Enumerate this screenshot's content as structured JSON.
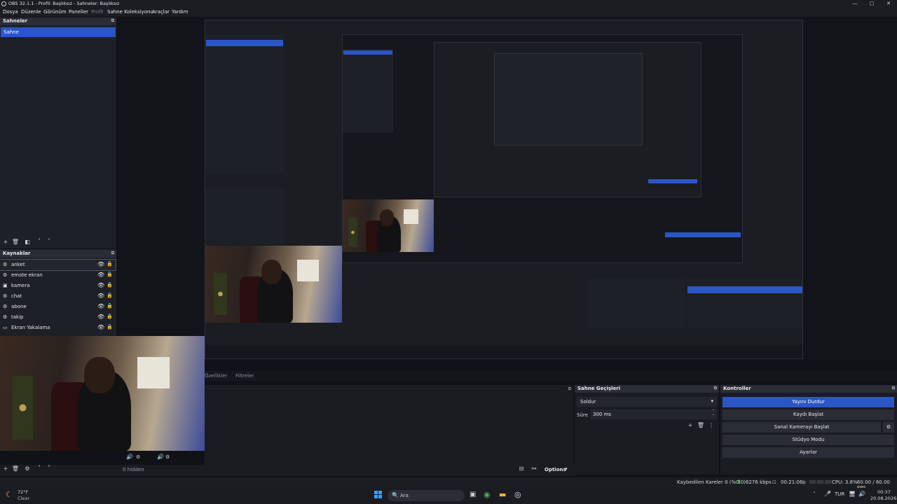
{
  "window": {
    "title": "OBS 32.1.1 - Profil: Başlıksız - Sahneler: Başlıksız",
    "min": "—",
    "max": "▢",
    "close": "✕"
  },
  "menu": [
    "Dosya",
    "Düzenle",
    "Görünüm",
    "Paneller",
    "Profil",
    "Sahne Koleksiyonu",
    "Araçlar",
    "Yardım"
  ],
  "scenes": {
    "header": "Sahneler",
    "items": [
      "Sahne"
    ]
  },
  "sources": {
    "header": "Kaynaklar",
    "items": [
      {
        "label": "anket",
        "icon": "gear"
      },
      {
        "label": "emote ekran",
        "icon": "gear"
      },
      {
        "label": "kamera",
        "icon": "camera"
      },
      {
        "label": "chat",
        "icon": "gear"
      },
      {
        "label": "abone",
        "icon": "gear"
      },
      {
        "label": "takip",
        "icon": "gear"
      },
      {
        "label": "Ekran Yakalama",
        "icon": "monitor"
      }
    ]
  },
  "tabs": {
    "properties": "Özellikler",
    "filters": "Filtreler"
  },
  "mixer": {
    "hidden": "0 hidden",
    "options": "Options"
  },
  "transitions": {
    "header": "Sahne Geçişleri",
    "selected": "Soldur",
    "duration_label": "Süre",
    "duration_value": "300 ms"
  },
  "controls": {
    "header": "Kontroller",
    "stop_stream": "Yayını Durdur",
    "start_record": "Kaydı Başlat",
    "virtual_cam": "Sanal Kamerayı Başlat",
    "studio_mode": "Stüdyo Modu",
    "settings": "Ayarlar"
  },
  "status": {
    "dropped": "Kaybedilen Kareler 0 (%0.0)",
    "kbps": "6276 kbps",
    "stream_time": "00:21:06",
    "rec_time": "00:00:00",
    "cpu": "CPU: 3.8%",
    "fps": "60.00 / 60.00 FPS"
  },
  "taskbar": {
    "weather_temp": "72°F",
    "weather_desc": "Clear",
    "search_placeholder": "Ara",
    "lang": "TUR",
    "time": "00:37",
    "date": "20.08.2026"
  }
}
